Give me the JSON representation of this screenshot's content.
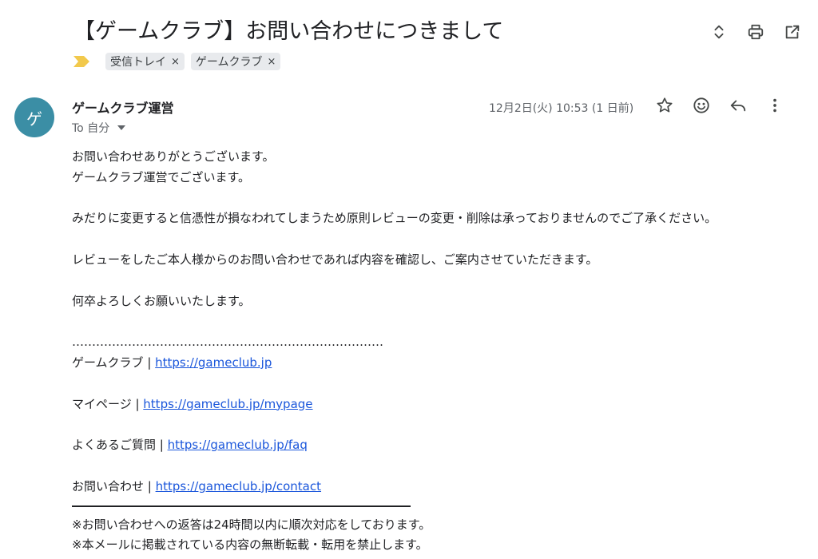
{
  "subject": "【ゲームクラブ】お問い合わせにつきまして",
  "top_actions": [
    {
      "name": "expand-collapse-icon"
    },
    {
      "name": "print-icon"
    },
    {
      "name": "open-in-new-window-icon"
    }
  ],
  "labels": [
    {
      "text": "受信トレイ",
      "close": "×"
    },
    {
      "text": "ゲームクラブ",
      "close": "×"
    }
  ],
  "message": {
    "avatar_letter": "ゲ",
    "sender": "ゲームクラブ運営",
    "to": "To 自分",
    "date": "12月2日(火) 10:53 (1 日前)",
    "actions": [
      {
        "name": "star-icon"
      },
      {
        "name": "emoji-reaction-icon"
      },
      {
        "name": "reply-icon"
      },
      {
        "name": "more-options-icon"
      }
    ]
  },
  "body": {
    "greeting1": "お問い合わせありがとうございます。",
    "greeting2": "ゲームクラブ運営でございます。",
    "para1": "みだりに変更すると信憑性が損なわれてしまうため原則レビューの変更・削除は承っておりませんのでご了承ください。",
    "para2": "レビューをしたご本人様からのお問い合わせであれば内容を確認し、ご案内させていただきます。",
    "closing": "何卒よろしくお願いいたします。",
    "dots": "……………………………………………………………………",
    "links": [
      {
        "label": "ゲームクラブ | ",
        "url": "https://gameclub.jp"
      },
      {
        "label": "マイページ | ",
        "url": "https://gameclub.jp/mypage"
      },
      {
        "label": "よくあるご質問 | ",
        "url": "https://gameclub.jp/faq"
      },
      {
        "label": "お問い合わせ | ",
        "url": "https://gameclub.jp/contact"
      }
    ],
    "note1": "※お問い合わせへの返答は24時間以内に順次対応をしております。",
    "note2": "※本メールに掲載されている内容の無断転載・転用を禁止します。"
  },
  "colors": {
    "avatar": "#3b8ea5",
    "link": "#1a56db",
    "chip": "#e8eaed",
    "importance_marker": "#f2c94c"
  }
}
